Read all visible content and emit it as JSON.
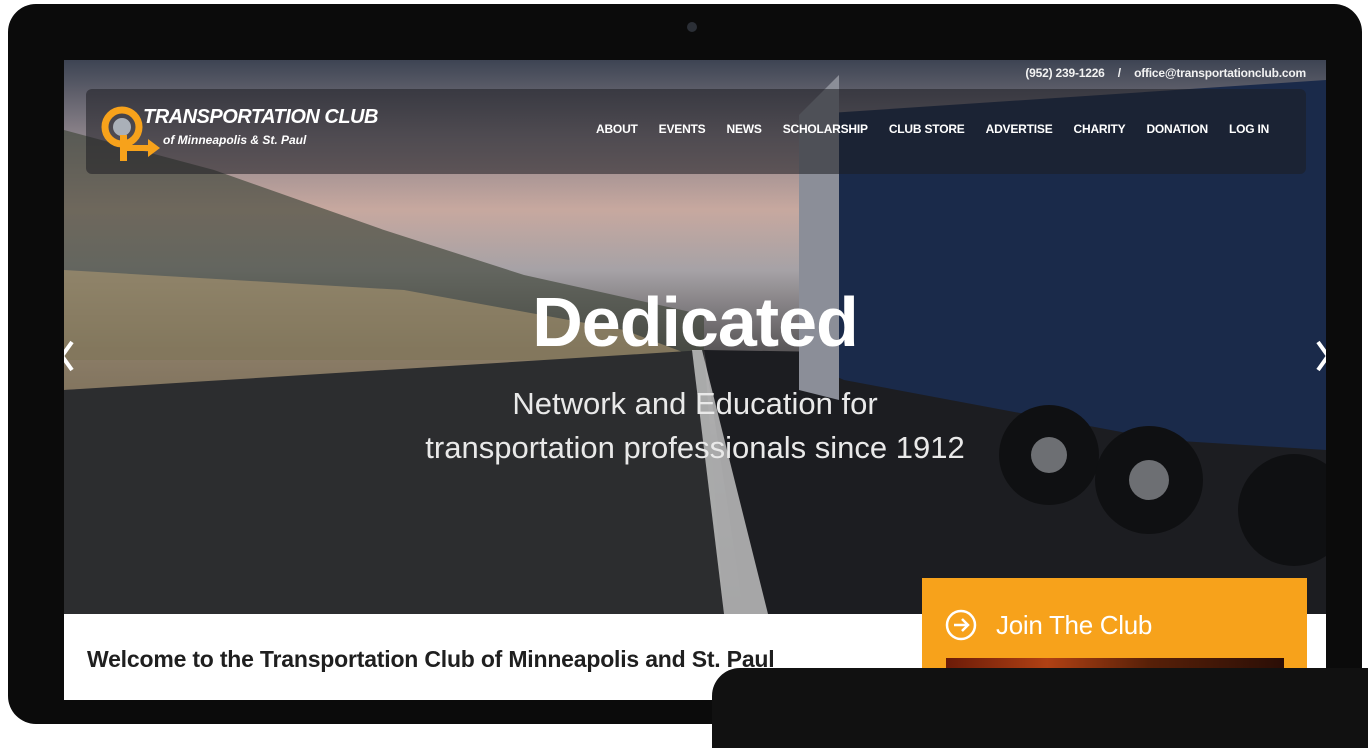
{
  "topbar": {
    "phone": "(952) 239-1226",
    "separator": "/",
    "email": "office@transportationclub.com"
  },
  "logo": {
    "title": "TRANSPORTATION CLUB",
    "subtitle": "of Minneapolis & St. Paul"
  },
  "nav": {
    "items": [
      {
        "label": "ABOUT"
      },
      {
        "label": "EVENTS"
      },
      {
        "label": "NEWS"
      },
      {
        "label": "SCHOLARSHIP"
      },
      {
        "label": "CLUB STORE"
      },
      {
        "label": "ADVERTISE"
      },
      {
        "label": "CHARITY"
      },
      {
        "label": "DONATION"
      },
      {
        "label": "LOG IN"
      }
    ]
  },
  "hero": {
    "title": "Dedicated",
    "subtitle_line1": "Network and Education for",
    "subtitle_line2": "transportation professionals since 1912"
  },
  "content": {
    "welcome_heading": "Welcome to the Transportation Club of Minneapolis and St. Paul"
  },
  "join": {
    "label": "Join The Club"
  },
  "colors": {
    "accent": "#f7a21b",
    "text_dark": "#1f1f1f"
  },
  "icons": {
    "slider_prev": "chevron-left-icon",
    "slider_next": "chevron-right-icon",
    "join": "arrow-circle-right-icon",
    "logo": "logo-mark-icon"
  }
}
